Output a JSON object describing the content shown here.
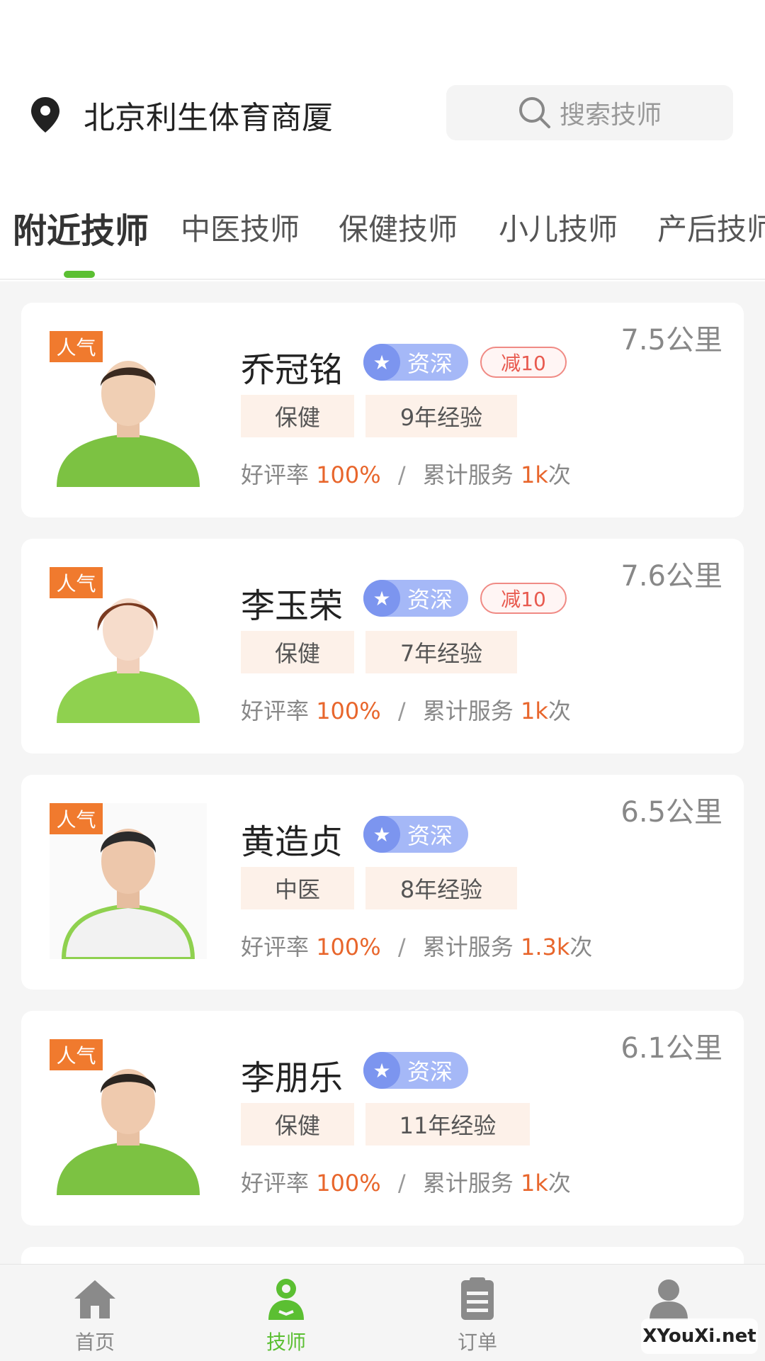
{
  "header": {
    "location": "北京利生体育商厦",
    "search_placeholder": "搜索技师"
  },
  "tabs": [
    {
      "label": "附近技师",
      "active": true
    },
    {
      "label": "中医技师",
      "active": false
    },
    {
      "label": "保健技师",
      "active": false
    },
    {
      "label": "小儿技师",
      "active": false
    },
    {
      "label": "产后技师",
      "active": false
    }
  ],
  "technicians": [
    {
      "badge": "人气",
      "name": "乔冠铭",
      "level": "资深",
      "discount": "减10",
      "distance": "7.5公里",
      "category": "保健",
      "experience": "9年经验",
      "rating_label": "好评率",
      "rating": "100%",
      "separator": "/",
      "service_label": "累计服务",
      "service_count": "1k",
      "service_unit": "次",
      "shirt_color": "#7cc242"
    },
    {
      "badge": "人气",
      "name": "李玉荣",
      "level": "资深",
      "discount": "减10",
      "distance": "7.6公里",
      "category": "保健",
      "experience": "7年经验",
      "rating_label": "好评率",
      "rating": "100%",
      "separator": "/",
      "service_label": "累计服务",
      "service_count": "1k",
      "service_unit": "次",
      "shirt_color": "#8fd14f"
    },
    {
      "badge": "人气",
      "name": "黄造贞",
      "level": "资深",
      "discount": "",
      "distance": "6.5公里",
      "category": "中医",
      "experience": "8年经验",
      "rating_label": "好评率",
      "rating": "100%",
      "separator": "/",
      "service_label": "累计服务",
      "service_count": "1.3k",
      "service_unit": "次",
      "shirt_color": "#f2f2f2"
    },
    {
      "badge": "人气",
      "name": "李朋乐",
      "level": "资深",
      "discount": "",
      "distance": "6.1公里",
      "category": "保健",
      "experience": "11年经验",
      "rating_label": "好评率",
      "rating": "100%",
      "separator": "/",
      "service_label": "累计服务",
      "service_count": "1k",
      "service_unit": "次",
      "shirt_color": "#7cc242"
    }
  ],
  "nav": [
    {
      "label": "首页",
      "icon": "home-icon",
      "active": false
    },
    {
      "label": "技师",
      "icon": "technician-icon",
      "active": true
    },
    {
      "label": "订单",
      "icon": "order-icon",
      "active": false
    },
    {
      "label": "",
      "icon": "user-icon",
      "active": false
    }
  ],
  "colors": {
    "accent": "#5bbf32",
    "highlight": "#e8662c",
    "badge": "#f07a2e",
    "senior": "#a5b8f7"
  },
  "watermark": "XYouXi.net"
}
